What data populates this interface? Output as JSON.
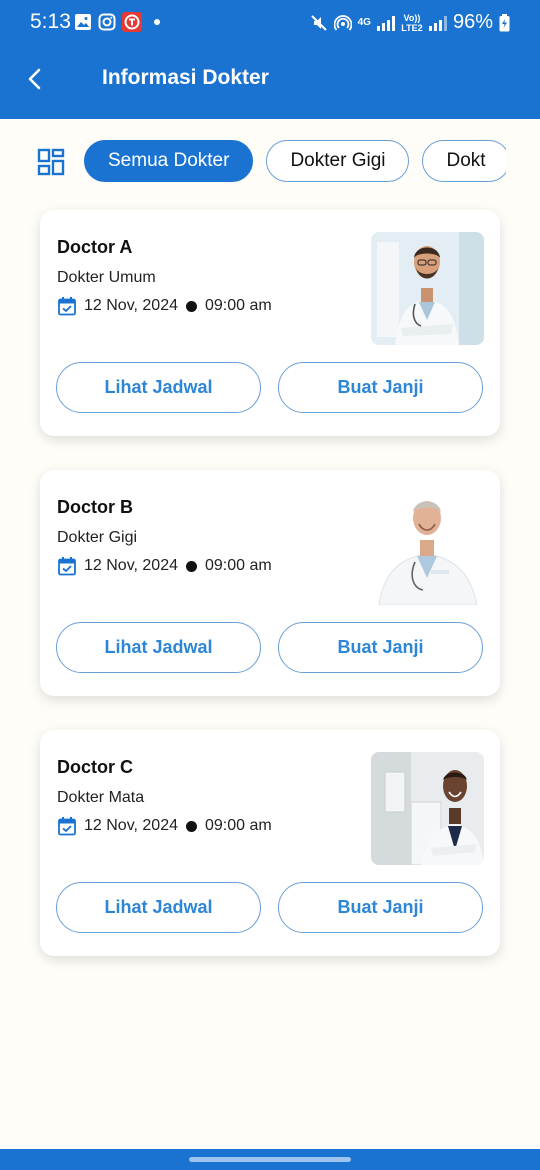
{
  "status_bar": {
    "time": "5:13",
    "battery": "96%",
    "net_top": "4G",
    "net_bottom": "Vo)) LTE2"
  },
  "header": {
    "title": "Informasi Dokter",
    "background_color": "#1a73d1"
  },
  "filters": {
    "chips": [
      {
        "label": "Semua Dokter",
        "active": true
      },
      {
        "label": "Dokter Gigi",
        "active": false
      },
      {
        "label": "Dokt",
        "active": false
      }
    ]
  },
  "doctors": [
    {
      "name": "Doctor A",
      "specialty": "Dokter Umum",
      "date": "12 Nov, 2024",
      "time": "09:00 am",
      "view_schedule_label": "Lihat Jadwal",
      "book_label": "Buat Janji"
    },
    {
      "name": "Doctor B",
      "specialty": "Dokter Gigi",
      "date": "12 Nov, 2024",
      "time": "09:00 am",
      "view_schedule_label": "Lihat Jadwal",
      "book_label": "Buat Janji"
    },
    {
      "name": "Doctor C",
      "specialty": "Dokter Mata",
      "date": "12 Nov, 2024",
      "time": "09:00 am",
      "view_schedule_label": "Lihat Jadwal",
      "book_label": "Buat Janji"
    }
  ],
  "icons": {
    "back": "chevron-left-icon",
    "grid": "grid-view-icon",
    "calendar": "calendar-check-icon"
  },
  "colors": {
    "primary": "#1a73d1",
    "button_text": "#2d86d6",
    "page_background": "#fffdf8"
  }
}
